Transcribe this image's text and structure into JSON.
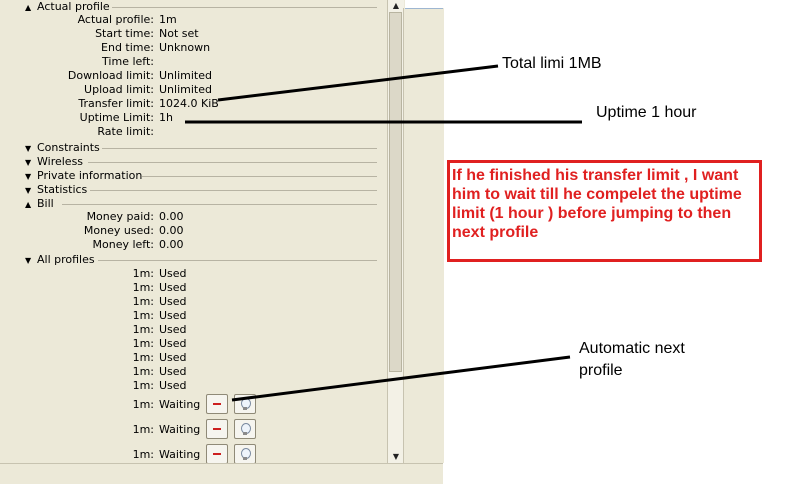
{
  "sections": {
    "actual_profile": "Actual profile",
    "constraints": "Constraints",
    "wireless": "Wireless",
    "private_info": "Private information",
    "statistics": "Statistics",
    "bill": "Bill",
    "all_profiles": "All profiles"
  },
  "profile_fields": [
    {
      "label": "Actual profile:",
      "value": "1m"
    },
    {
      "label": "Start time:",
      "value": "Not set"
    },
    {
      "label": "End time:",
      "value": "Unknown"
    },
    {
      "label": "Time left:",
      "value": ""
    },
    {
      "label": "Download limit:",
      "value": "Unlimited"
    },
    {
      "label": "Upload limit:",
      "value": "Unlimited"
    },
    {
      "label": "Transfer limit:",
      "value": "1024.0 KiB"
    },
    {
      "label": "Uptime Limit:",
      "value": "1h"
    },
    {
      "label": "Rate limit:",
      "value": ""
    }
  ],
  "bill_fields": [
    {
      "label": "Money paid:",
      "value": "0.00"
    },
    {
      "label": "Money used:",
      "value": "0.00"
    },
    {
      "label": "Money left:",
      "value": "0.00"
    }
  ],
  "profiles": [
    {
      "label": "1m:",
      "status": "Used"
    },
    {
      "label": "1m:",
      "status": "Used"
    },
    {
      "label": "1m:",
      "status": "Used"
    },
    {
      "label": "1m:",
      "status": "Used"
    },
    {
      "label": "1m:",
      "status": "Used"
    },
    {
      "label": "1m:",
      "status": "Used"
    },
    {
      "label": "1m:",
      "status": "Used"
    },
    {
      "label": "1m:",
      "status": "Used"
    },
    {
      "label": "1m:",
      "status": "Used"
    },
    {
      "label": "1m:",
      "status": "Waiting"
    },
    {
      "label": "1m:",
      "status": "Waiting"
    },
    {
      "label": "1m:",
      "status": "Waiting"
    }
  ],
  "annotations": {
    "total_limit": "Total limi 1MB",
    "uptime": "Uptime 1 hour",
    "automatic_next_1": "Automatic next",
    "automatic_next_2": "profile",
    "red_note": "If he finished his transfer limit , I want him to wait till he compelet the uptime limit (1 hour ) before jumping to then next profile"
  },
  "colors": {
    "panel_bg": "#ece9d8",
    "annotation_red": "#e02020",
    "remove_icon": "#cc2020"
  }
}
